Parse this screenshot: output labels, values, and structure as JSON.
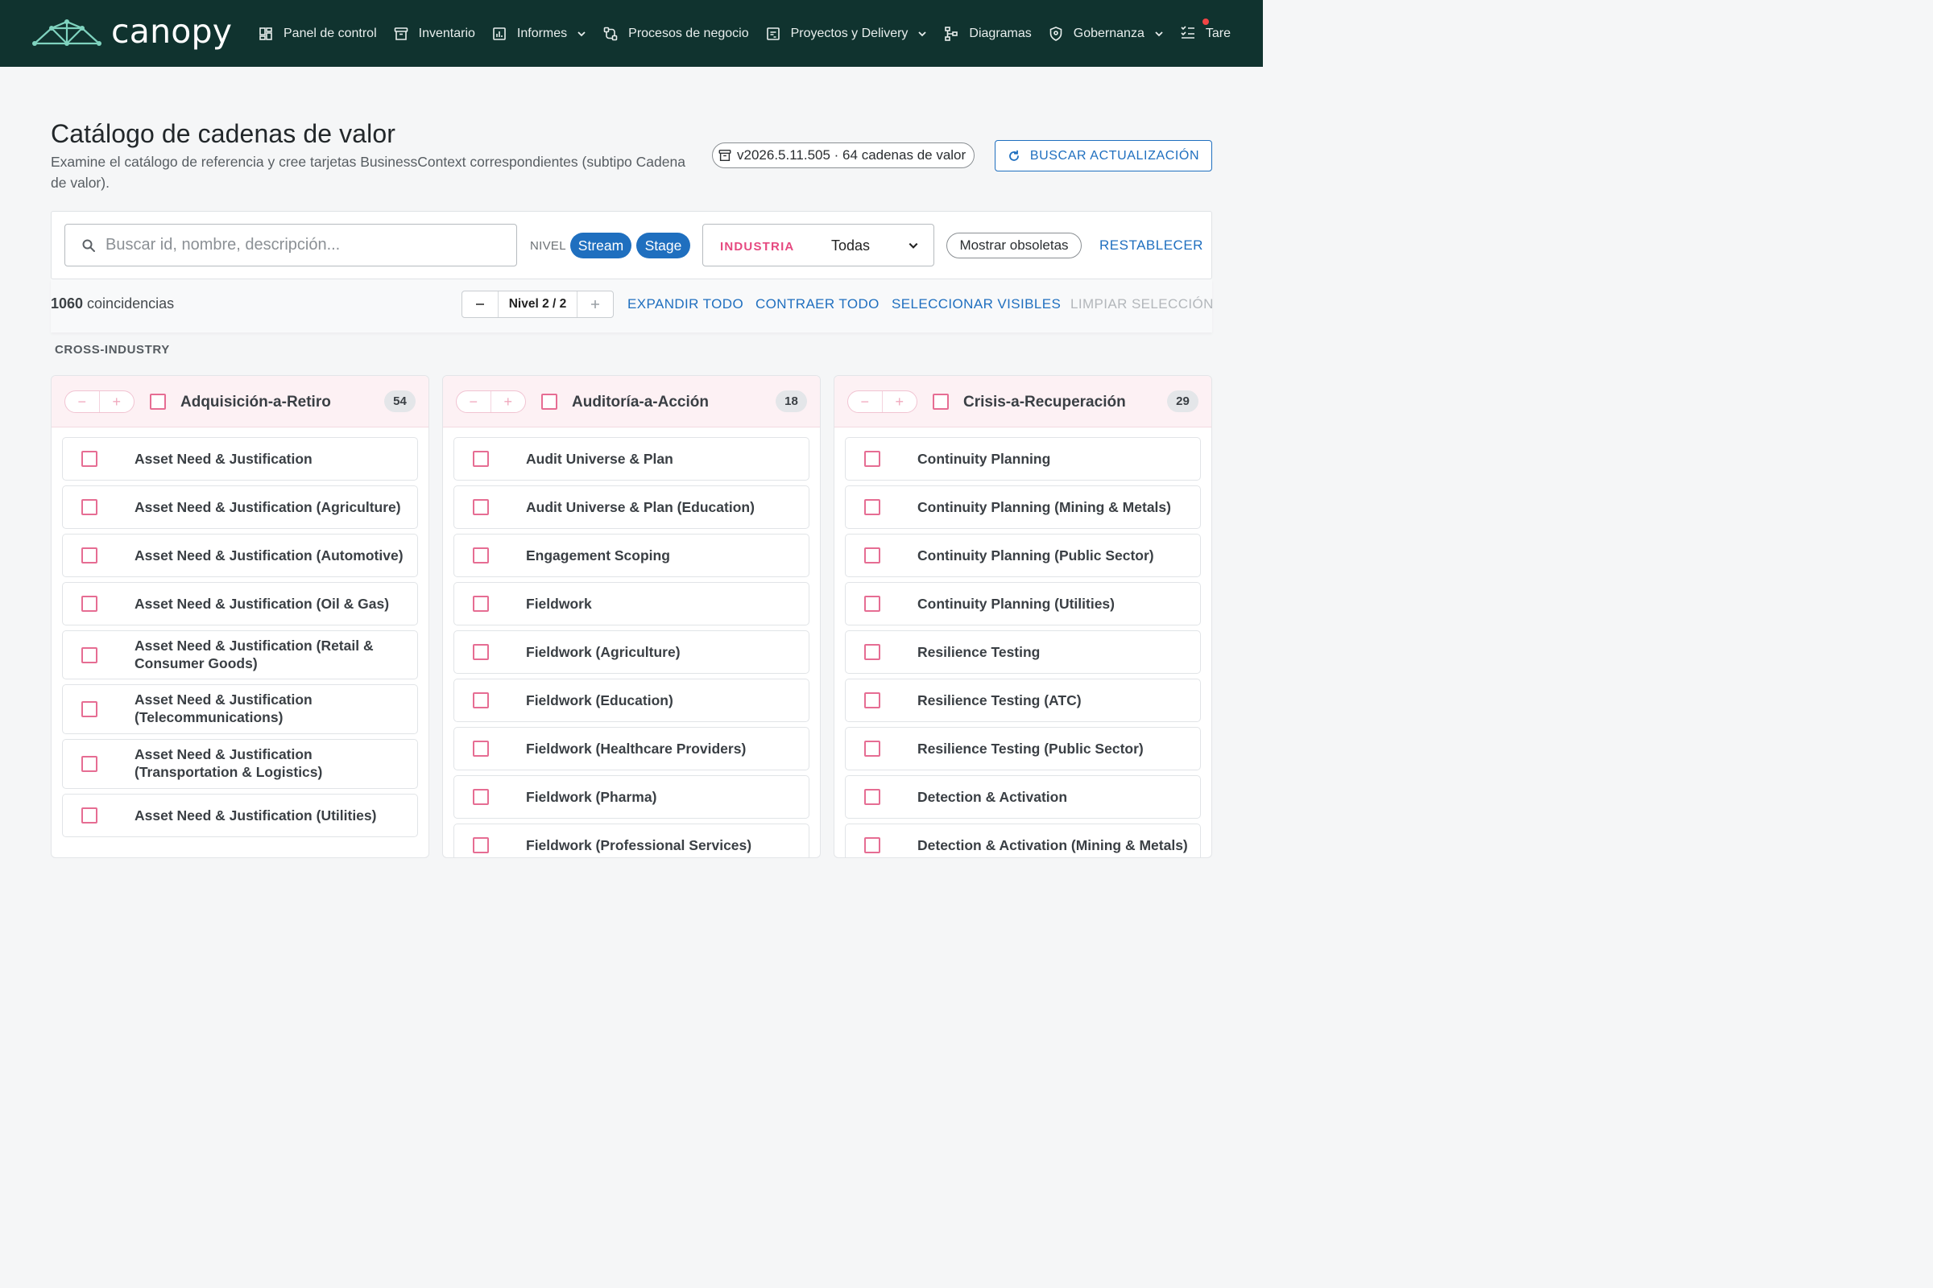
{
  "brand": {
    "name": "canopy"
  },
  "nav": [
    {
      "label": "Panel de control",
      "icon": "dashboard-icon",
      "chevron": false
    },
    {
      "label": "Inventario",
      "icon": "archive-icon",
      "chevron": false
    },
    {
      "label": "Informes",
      "icon": "report-icon",
      "chevron": true
    },
    {
      "label": "Procesos de negocio",
      "icon": "process-icon",
      "chevron": false
    },
    {
      "label": "Proyectos y Delivery",
      "icon": "project-icon",
      "chevron": true
    },
    {
      "label": "Diagramas",
      "icon": "diagram-icon",
      "chevron": false
    },
    {
      "label": "Gobernanza",
      "icon": "shield-icon",
      "chevron": true
    },
    {
      "label": "Tare",
      "icon": "tasks-icon",
      "chevron": false
    }
  ],
  "header": {
    "title": "Catálogo de cadenas de valor",
    "subtitle": "Examine el catálogo de referencia y cree tarjetas BusinessContext correspondientes (subtipo Cadena de valor).",
    "version": "v2026.5.11.505 · 64 cadenas de valor",
    "update_button": "BUSCAR ACTUALIZACIÓN"
  },
  "filters": {
    "search_placeholder": "Buscar id, nombre, descripción...",
    "search_value": "",
    "nivel_label": "NIVEL",
    "chip_stream": "Stream",
    "chip_stage": "Stage",
    "industry_label": "INDUSTRIA",
    "industry_value": "Todas",
    "show_obsolete": "Mostrar obsoletas",
    "reset": "RESTABLECER"
  },
  "toolbar": {
    "match_number": "1060",
    "match_suffix": " coincidencias",
    "level": "Nivel 2 / 2",
    "expand_all": "EXPANDIR TODO",
    "collapse_all": "CONTRAER TODO",
    "select_visible": "SELECCIONAR VISIBLES",
    "clear_selection": "LIMPIAR SELECCIÓN"
  },
  "section": {
    "label": "CROSS-INDUSTRY"
  },
  "columns": [
    {
      "title": "Adquisición-a-Retiro",
      "count": "54",
      "items": [
        "Asset Need & Justification",
        "Asset Need & Justification (Agriculture)",
        "Asset Need & Justification (Automotive)",
        "Asset Need & Justification (Oil & Gas)",
        "Asset Need & Justification (Retail & Consumer Goods)",
        "Asset Need & Justification (Telecommunications)",
        "Asset Need & Justification (Transportation & Logistics)",
        "Asset Need & Justification (Utilities)"
      ]
    },
    {
      "title": "Auditoría-a-Acción",
      "count": "18",
      "items": [
        "Audit Universe & Plan",
        "Audit Universe & Plan (Education)",
        "Engagement Scoping",
        "Fieldwork",
        "Fieldwork (Agriculture)",
        "Fieldwork (Education)",
        "Fieldwork (Healthcare Providers)",
        "Fieldwork (Pharma)",
        "Fieldwork (Professional Services)"
      ]
    },
    {
      "title": "Crisis-a-Recuperación",
      "count": "29",
      "items": [
        "Continuity Planning",
        "Continuity Planning (Mining & Metals)",
        "Continuity Planning (Public Sector)",
        "Continuity Planning (Utilities)",
        "Resilience Testing",
        "Resilience Testing (ATC)",
        "Resilience Testing (Public Sector)",
        "Detection & Activation",
        "Detection & Activation (Mining & Metals)"
      ]
    }
  ]
}
